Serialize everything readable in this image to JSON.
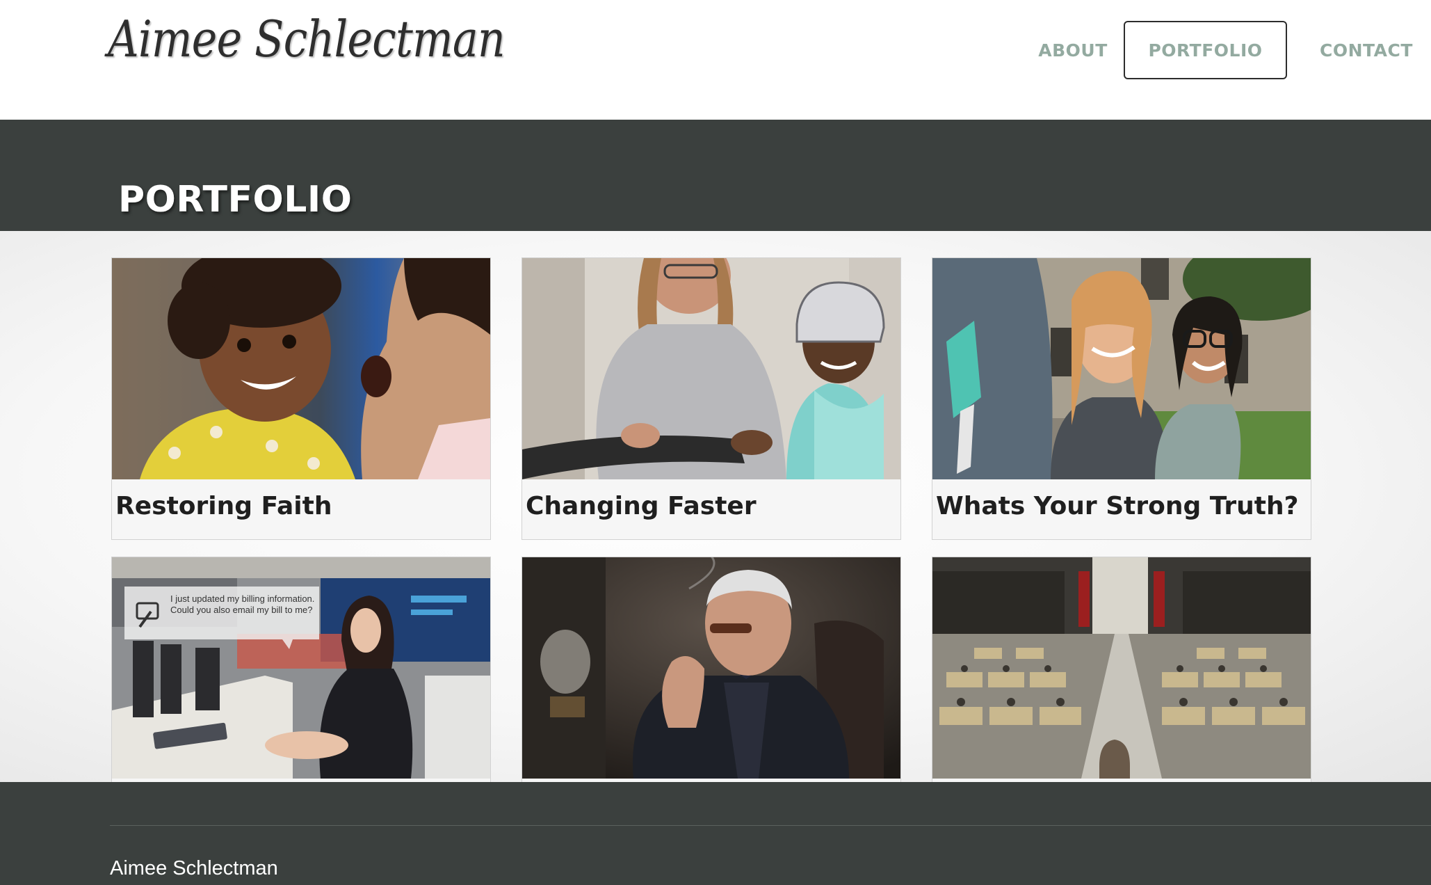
{
  "site": {
    "logo_text": "Aimee Schlectman"
  },
  "nav": {
    "items": [
      {
        "label": "ABOUT",
        "active": false
      },
      {
        "label": "PORTFOLIO",
        "active": true
      },
      {
        "label": "CONTACT",
        "active": false
      }
    ]
  },
  "page": {
    "title": "PORTFOLIO"
  },
  "portfolio": {
    "items": [
      {
        "title": "Restoring Faith",
        "thumbnail": "child-and-woman-smiling-photo"
      },
      {
        "title": "Changing Faster",
        "thumbnail": "boy-in-helmet-with-woman-photo"
      },
      {
        "title": "Whats Your Strong Truth?",
        "thumbnail": "two-women-laughing-outdoors-photo"
      },
      {
        "title": "",
        "thumbnail": "woman-at-desk-with-phone-photo",
        "speech_bubble": "I just updated my billing information. Could you also email my bill to me?"
      },
      {
        "title": "",
        "thumbnail": "man-smoking-cigar-photo"
      },
      {
        "title": "",
        "thumbnail": "large-hall-with-desks-photo"
      }
    ]
  },
  "footer": {
    "name": "Aimee Schlectman"
  },
  "colors": {
    "nav_text": "#93aaa0",
    "band_bg": "#3b403e",
    "card_bg": "#f6f6f6",
    "caption_text": "#1f1f1f"
  }
}
